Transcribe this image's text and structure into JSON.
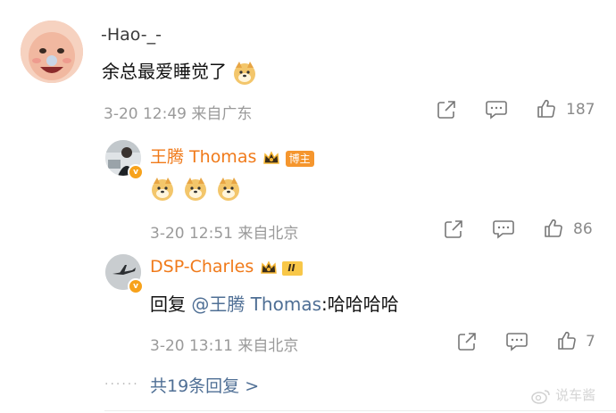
{
  "comment": {
    "author": "-Hao-_-",
    "text": "余总最爱睡觉了",
    "meta": "3-20 12:49 来自广东",
    "like_count": "187"
  },
  "reply1": {
    "author": "王腾 Thomas",
    "author_badge": "博主",
    "meta": "3-20 12:51 来自北京",
    "like_count": "86"
  },
  "reply2": {
    "author": "DSP-Charles",
    "level_badge": "II",
    "text_prefix": "回复",
    "mention": "@王腾 Thomas",
    "text_suffix": ":哈哈哈哈",
    "meta": "3-20 13:11 来自北京",
    "like_count": "7"
  },
  "more_replies": {
    "label": "共19条回复 >"
  },
  "watermark": {
    "text": "说车酱"
  },
  "colors": {
    "orange_name": "#f07a1a",
    "link_blue": "#4f6f95",
    "meta_gray": "#9a9a9a"
  },
  "icons": [
    "share-icon",
    "comment-icon",
    "like-icon",
    "doge-emoji",
    "vip-crown-icon",
    "verified-badge-icon",
    "weibo-logo-icon"
  ]
}
